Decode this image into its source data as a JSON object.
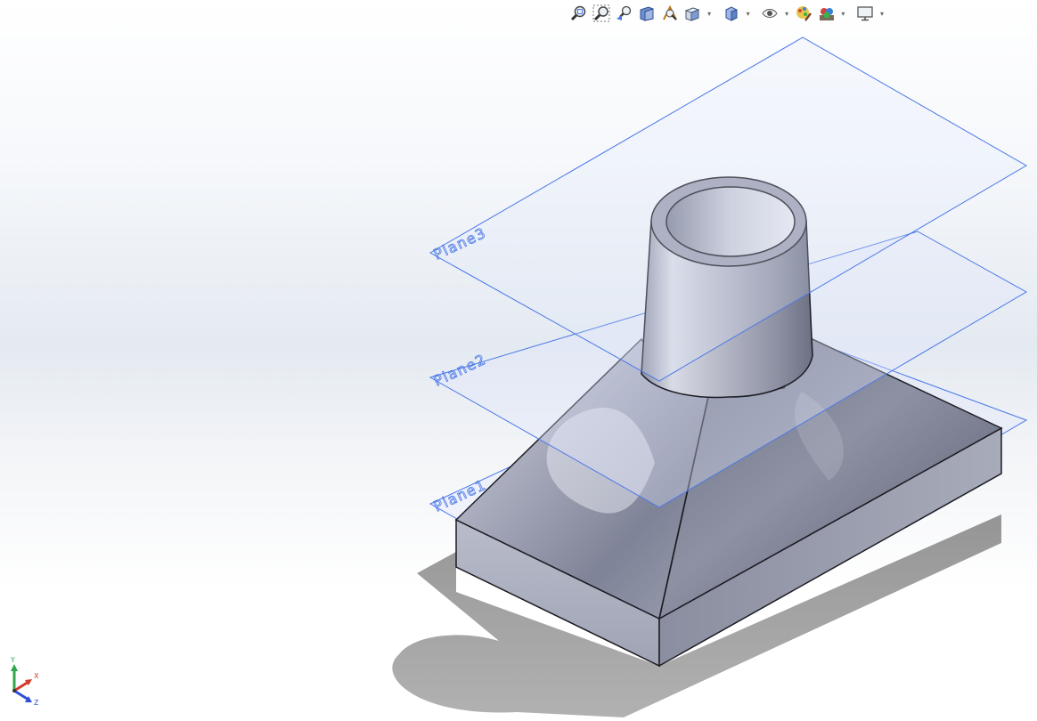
{
  "toolbar": {
    "items": [
      {
        "name": "zoom-to-fit",
        "icon": "zoom-to-fit-icon"
      },
      {
        "name": "zoom-to-area",
        "icon": "zoom-to-area-icon"
      },
      {
        "name": "previous-view",
        "icon": "previous-view-icon"
      },
      {
        "name": "section-view",
        "icon": "section-view-icon"
      },
      {
        "name": "dynamic-annotation-views",
        "icon": "dynamic-annotation-icon"
      },
      {
        "name": "view-orientation",
        "icon": "view-orientation-icon",
        "dropdown": true
      },
      {
        "name": "display-style",
        "icon": "display-style-icon",
        "dropdown": true
      },
      {
        "name": "hide-show-items",
        "icon": "hide-show-items-icon",
        "dropdown": true
      },
      {
        "name": "edit-appearance",
        "icon": "edit-appearance-icon"
      },
      {
        "name": "apply-scene",
        "icon": "apply-scene-icon",
        "dropdown": true
      },
      {
        "name": "view-settings",
        "icon": "view-settings-icon",
        "dropdown": true
      }
    ]
  },
  "planes": {
    "plane1": "Plane1",
    "plane2": "Plane2",
    "plane3": "Plane3"
  },
  "triad": {
    "x_label": "X",
    "y_label": "Y",
    "z_label": "Z"
  },
  "colors": {
    "plane_edge": "#4a78e8",
    "plane_fill": "#dfe6fb",
    "model_body": "#8d92a4",
    "edge_line": "#1c1c24",
    "shadow": "#8c8c8c"
  }
}
